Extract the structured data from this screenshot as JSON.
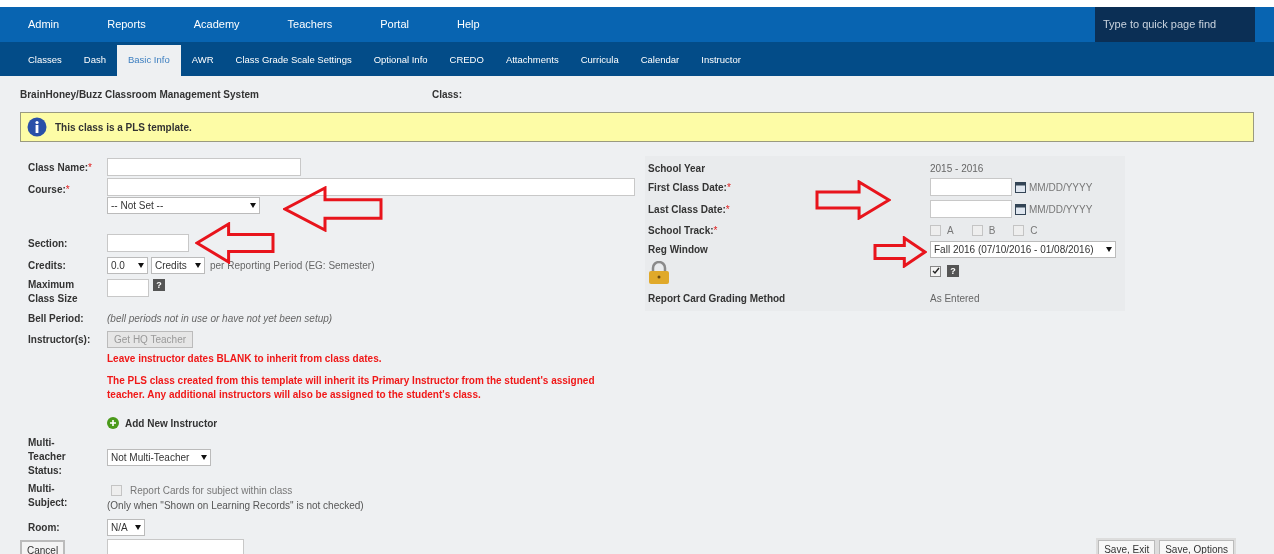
{
  "top_nav": {
    "items": [
      "Admin",
      "Reports",
      "Academy",
      "Teachers",
      "Portal",
      "Help"
    ],
    "search": {
      "placeholder": "Type to quick page find"
    }
  },
  "tabs": [
    {
      "label": "Classes",
      "selected": false
    },
    {
      "label": "Dash",
      "selected": false
    },
    {
      "label": "Basic Info",
      "selected": true
    },
    {
      "label": "AWR",
      "selected": false
    },
    {
      "label": "Class Grade Scale Settings",
      "selected": false
    },
    {
      "label": "Optional Info",
      "selected": false
    },
    {
      "label": "CREDO",
      "selected": false
    },
    {
      "label": "Attachments",
      "selected": false
    },
    {
      "label": "Curricula",
      "selected": false
    },
    {
      "label": "Calendar",
      "selected": false
    },
    {
      "label": "Instructor",
      "selected": false
    }
  ],
  "header": {
    "title": "BrainHoney/Buzz Classroom Management System",
    "class_label": "Class:"
  },
  "notice": "This class is a PLS template.",
  "left_form": {
    "class_name": {
      "label": "Class Name:",
      "marker": "*"
    },
    "course": {
      "label": "Course:",
      "marker": "*",
      "select": "-- Not Set --"
    },
    "section": {
      "label": "Section:"
    },
    "credits": {
      "label": "Credits:",
      "amount": "0.0",
      "unit": "Credits",
      "note": "per Reporting Period (EG: Semester)"
    },
    "max_size": {
      "label": "Maximum Class Size",
      "help": "?"
    },
    "bell_period": {
      "label": "Bell Period:",
      "note": "(bell periods not in use or have not yet been setup)"
    },
    "instructors": {
      "label": "Instructor(s):",
      "button": "Get HQ Teacher",
      "warning": "Leave instructor dates BLANK to inherit from class dates.",
      "info": "The PLS class created from this template will inherit its Primary Instructor from the student's assigned teacher. Any additional instructors will also be assigned to the student's class.",
      "add": "Add New Instructor"
    },
    "multi_teacher": {
      "label": "Multi-Teacher Status:",
      "select": "Not Multi-Teacher"
    },
    "multi_subject": {
      "label": "Multi-Subject:",
      "checkbox": "Report Cards for subject within class",
      "checked": false,
      "note": "(Only when \"Shown on Learning Records\" is not checked)"
    },
    "room": {
      "label": "Room:",
      "select": "N/A"
    }
  },
  "right_form": {
    "school_year": {
      "label": "School Year",
      "value": "2015 - 2016"
    },
    "first_date": {
      "label": "First Class Date:",
      "marker": "*",
      "format": "MM/DD/YYYY"
    },
    "last_date": {
      "label": "Last Class Date:",
      "marker": "*",
      "format": "MM/DD/YYYY"
    },
    "track": {
      "label": "School Track:",
      "marker": "*",
      "options": [
        {
          "label": "A",
          "checked": false
        },
        {
          "label": "B",
          "checked": false
        },
        {
          "label": "C",
          "checked": false
        }
      ]
    },
    "reg_window": {
      "label": "Reg Window",
      "select": "Fall 2016 (07/10/2016 - 01/08/2016)"
    },
    "locked": {
      "checked": true,
      "help": "?"
    },
    "grading": {
      "label": "Report Card Grading Method",
      "value": "As Entered"
    }
  },
  "footer": {
    "cancel": "Cancel",
    "buttons": [
      "Save, Exit",
      "Save, Options"
    ]
  }
}
